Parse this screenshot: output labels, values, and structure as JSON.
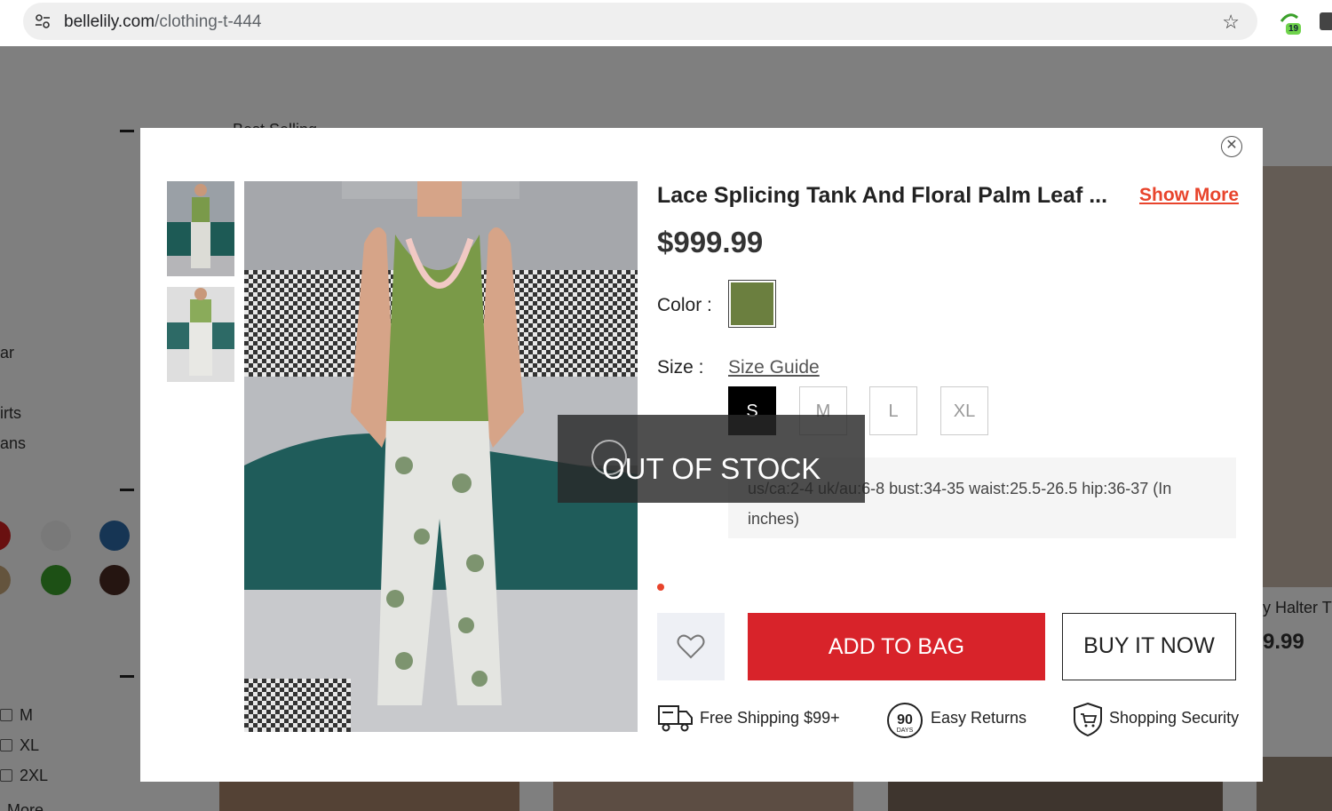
{
  "browser": {
    "url_host": "bellelily.com",
    "url_path": "/clothing-t-444",
    "extension_badge": "19"
  },
  "background_page": {
    "sort_label": "Best Selling",
    "sidebar_fragments": [
      "ar",
      "irts",
      "ans"
    ],
    "size_filters": [
      "M",
      "XL",
      "2XL"
    ],
    "more_link": "More",
    "color_swatches": [
      "#d32020",
      "#f2f2f2",
      "#2d6aa8",
      "#c8a87a",
      "#3aa02a",
      "#4a2a22"
    ],
    "side_product_name_fragment": "y Halter T",
    "side_product_price_fragment": "9.99"
  },
  "modal": {
    "close_icon": "close-icon",
    "product_title": "Lace Splicing Tank And Floral Palm Leaf ...",
    "show_more": "Show More",
    "price": "$999.99",
    "color_label": "Color :",
    "selected_color": "#6b7f3f",
    "size_label": "Size :",
    "size_guide": "Size Guide",
    "sizes": [
      "S",
      "M",
      "L",
      "XL"
    ],
    "selected_size": "S",
    "size_info": "us/ca:2-4 uk/au:6-8 bust:34-35 waist:25.5-26.5 hip:36-37 (In inches)",
    "add_to_bag": "ADD TO BAG",
    "buy_now": "BUY IT NOW",
    "perks": {
      "shipping": "Free Shipping $99+",
      "returns_days": "90",
      "returns_unit": "DAYS",
      "returns": "Easy Returns",
      "security": "Shopping Security"
    },
    "out_of_stock": "OUT OF STOCK"
  }
}
